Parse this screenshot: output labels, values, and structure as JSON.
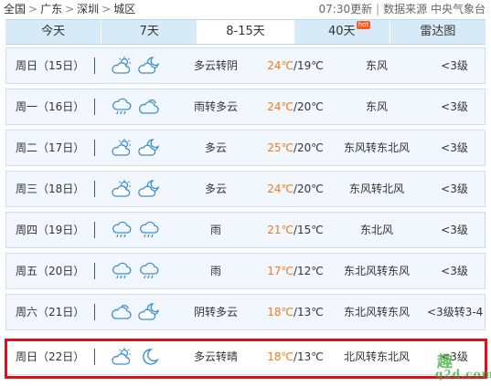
{
  "breadcrumb": {
    "items": [
      "全国",
      "广东",
      "深圳",
      "城区"
    ],
    "separator": ">"
  },
  "meta": {
    "update": "07:30更新",
    "divider": "|",
    "source": "数据来源 中央气象台"
  },
  "tabs": [
    {
      "label": "今天",
      "active": false
    },
    {
      "label": "7天",
      "active": false
    },
    {
      "label": "8-15天",
      "active": true
    },
    {
      "label": "40天",
      "active": false,
      "badge": "hot"
    },
    {
      "label": "雷达图",
      "active": false
    }
  ],
  "forecast": [
    {
      "date": "周日（15日）",
      "icon1": "partly-cloudy-sun-icon",
      "icon2": "cloudy-moon-icon",
      "weather": "多云转阴",
      "high": "24℃",
      "low": "/19℃",
      "wind": "东风",
      "level": "<3级"
    },
    {
      "date": "周一（16日）",
      "icon1": "rain-cloud-icon",
      "icon2": "cloud-icon",
      "weather": "雨转多云",
      "high": "24℃",
      "low": "/20℃",
      "wind": "东风",
      "level": "<3级"
    },
    {
      "date": "周二（17日）",
      "icon1": "partly-cloudy-sun-icon",
      "icon2": "cloudy-moon-icon",
      "weather": "多云",
      "high": "25℃",
      "low": "/20℃",
      "wind": "东风转东北风",
      "level": "<3级"
    },
    {
      "date": "周三（18日）",
      "icon1": "partly-cloudy-sun-icon",
      "icon2": "cloudy-moon-icon",
      "weather": "多云",
      "high": "24℃",
      "low": "/20℃",
      "wind": "东风转北风",
      "level": "<3级"
    },
    {
      "date": "周四（19日）",
      "icon1": "rain-cloud-icon",
      "icon2": "rain-cloud-icon",
      "weather": "雨",
      "high": "21℃",
      "low": "/15℃",
      "wind": "东北风",
      "level": "<3级"
    },
    {
      "date": "周五（20日）",
      "icon1": "rain-cloud-icon",
      "icon2": "rain-cloud-icon",
      "weather": "雨",
      "high": "17℃",
      "low": "/12℃",
      "wind": "东北风转东风",
      "level": "<3级"
    },
    {
      "date": "周六（21日）",
      "icon1": "cloud-icon",
      "icon2": "cloudy-moon-icon",
      "weather": "阴转多云",
      "high": "18℃",
      "low": "/13℃",
      "wind": "东北风转东风",
      "level": "<3级转3-4"
    },
    {
      "date": "周日（22日）",
      "icon1": "partly-cloudy-sun-icon",
      "icon2": "moon-icon",
      "weather": "多云转晴",
      "high": "18℃",
      "low": "/13℃",
      "wind": "北风转东北风",
      "level": "<3级"
    }
  ],
  "watermark": {
    "line1": "趣",
    "line2": "q2d.com"
  },
  "colors": {
    "tab_bg": "#d7eaf8",
    "row_bg": "#f1f7fd",
    "row_border": "#c9e0f3",
    "high_temp": "#f07a1f",
    "icon_blue": "#3d8fcf",
    "highlight": "#e0101a",
    "watermark": "#3fa63a"
  }
}
